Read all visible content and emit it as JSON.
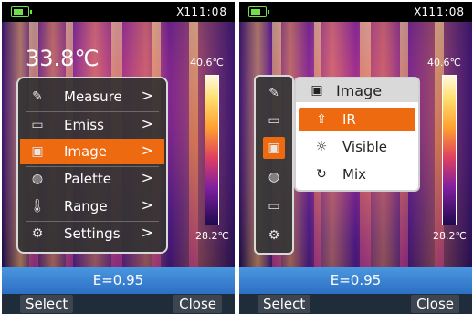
{
  "screens": [
    {
      "status": {
        "model": "X1",
        "time": "11:08",
        "battery_icon": "battery-icon"
      },
      "temp_center": "33.8℃",
      "scale": {
        "max": "40.6℃",
        "min": "28.2℃"
      },
      "emissivity": "E=0.95",
      "softkeys": {
        "left": "Select",
        "right": "Close"
      },
      "menu": [
        {
          "label": "Measure",
          "icon": "measure-icon",
          "chevron": ">"
        },
        {
          "label": "Emiss",
          "icon": "emiss-icon",
          "chevron": ">"
        },
        {
          "label": "Image",
          "icon": "image-icon",
          "chevron": ">"
        },
        {
          "label": "Palette",
          "icon": "palette-icon",
          "chevron": ">"
        },
        {
          "label": "Range",
          "icon": "range-icon",
          "chevron": ">"
        },
        {
          "label": "Settings",
          "icon": "settings-icon",
          "chevron": ">"
        }
      ],
      "selected_menu": "Image"
    },
    {
      "status": {
        "model": "X1",
        "time": "11:08",
        "battery_icon": "battery-icon"
      },
      "scale": {
        "max": "40.6℃",
        "min": "28.2℃"
      },
      "emissivity": "E=0.95",
      "softkeys": {
        "left": "Select",
        "right": "Close"
      },
      "submenu": {
        "title": "Image",
        "items": [
          {
            "label": "IR",
            "icon": "export-icon"
          },
          {
            "label": "Visible",
            "icon": "bulb-icon"
          },
          {
            "label": "Mix",
            "icon": "mix-icon"
          }
        ],
        "selected": "IR"
      },
      "icon_column": [
        "measure-icon",
        "emiss-icon",
        "image-icon",
        "palette-icon",
        "camera-icon",
        "settings-icon"
      ]
    }
  ],
  "colors": {
    "accent": "#ee6a10",
    "emiss_bar": "#3f86d6",
    "battery": "#6fe04a"
  }
}
